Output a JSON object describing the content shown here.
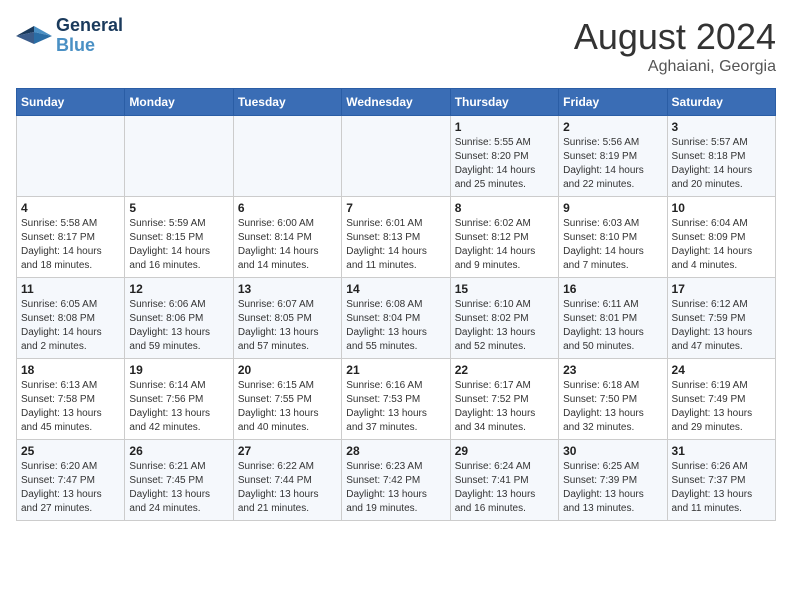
{
  "header": {
    "logo_line1": "General",
    "logo_line2": "Blue",
    "month_year": "August 2024",
    "location": "Aghaiani, Georgia"
  },
  "days_of_week": [
    "Sunday",
    "Monday",
    "Tuesday",
    "Wednesday",
    "Thursday",
    "Friday",
    "Saturday"
  ],
  "weeks": [
    [
      {
        "day": "",
        "info": ""
      },
      {
        "day": "",
        "info": ""
      },
      {
        "day": "",
        "info": ""
      },
      {
        "day": "",
        "info": ""
      },
      {
        "day": "1",
        "info": "Sunrise: 5:55 AM\nSunset: 8:20 PM\nDaylight: 14 hours\nand 25 minutes."
      },
      {
        "day": "2",
        "info": "Sunrise: 5:56 AM\nSunset: 8:19 PM\nDaylight: 14 hours\nand 22 minutes."
      },
      {
        "day": "3",
        "info": "Sunrise: 5:57 AM\nSunset: 8:18 PM\nDaylight: 14 hours\nand 20 minutes."
      }
    ],
    [
      {
        "day": "4",
        "info": "Sunrise: 5:58 AM\nSunset: 8:17 PM\nDaylight: 14 hours\nand 18 minutes."
      },
      {
        "day": "5",
        "info": "Sunrise: 5:59 AM\nSunset: 8:15 PM\nDaylight: 14 hours\nand 16 minutes."
      },
      {
        "day": "6",
        "info": "Sunrise: 6:00 AM\nSunset: 8:14 PM\nDaylight: 14 hours\nand 14 minutes."
      },
      {
        "day": "7",
        "info": "Sunrise: 6:01 AM\nSunset: 8:13 PM\nDaylight: 14 hours\nand 11 minutes."
      },
      {
        "day": "8",
        "info": "Sunrise: 6:02 AM\nSunset: 8:12 PM\nDaylight: 14 hours\nand 9 minutes."
      },
      {
        "day": "9",
        "info": "Sunrise: 6:03 AM\nSunset: 8:10 PM\nDaylight: 14 hours\nand 7 minutes."
      },
      {
        "day": "10",
        "info": "Sunrise: 6:04 AM\nSunset: 8:09 PM\nDaylight: 14 hours\nand 4 minutes."
      }
    ],
    [
      {
        "day": "11",
        "info": "Sunrise: 6:05 AM\nSunset: 8:08 PM\nDaylight: 14 hours\nand 2 minutes."
      },
      {
        "day": "12",
        "info": "Sunrise: 6:06 AM\nSunset: 8:06 PM\nDaylight: 13 hours\nand 59 minutes."
      },
      {
        "day": "13",
        "info": "Sunrise: 6:07 AM\nSunset: 8:05 PM\nDaylight: 13 hours\nand 57 minutes."
      },
      {
        "day": "14",
        "info": "Sunrise: 6:08 AM\nSunset: 8:04 PM\nDaylight: 13 hours\nand 55 minutes."
      },
      {
        "day": "15",
        "info": "Sunrise: 6:10 AM\nSunset: 8:02 PM\nDaylight: 13 hours\nand 52 minutes."
      },
      {
        "day": "16",
        "info": "Sunrise: 6:11 AM\nSunset: 8:01 PM\nDaylight: 13 hours\nand 50 minutes."
      },
      {
        "day": "17",
        "info": "Sunrise: 6:12 AM\nSunset: 7:59 PM\nDaylight: 13 hours\nand 47 minutes."
      }
    ],
    [
      {
        "day": "18",
        "info": "Sunrise: 6:13 AM\nSunset: 7:58 PM\nDaylight: 13 hours\nand 45 minutes."
      },
      {
        "day": "19",
        "info": "Sunrise: 6:14 AM\nSunset: 7:56 PM\nDaylight: 13 hours\nand 42 minutes."
      },
      {
        "day": "20",
        "info": "Sunrise: 6:15 AM\nSunset: 7:55 PM\nDaylight: 13 hours\nand 40 minutes."
      },
      {
        "day": "21",
        "info": "Sunrise: 6:16 AM\nSunset: 7:53 PM\nDaylight: 13 hours\nand 37 minutes."
      },
      {
        "day": "22",
        "info": "Sunrise: 6:17 AM\nSunset: 7:52 PM\nDaylight: 13 hours\nand 34 minutes."
      },
      {
        "day": "23",
        "info": "Sunrise: 6:18 AM\nSunset: 7:50 PM\nDaylight: 13 hours\nand 32 minutes."
      },
      {
        "day": "24",
        "info": "Sunrise: 6:19 AM\nSunset: 7:49 PM\nDaylight: 13 hours\nand 29 minutes."
      }
    ],
    [
      {
        "day": "25",
        "info": "Sunrise: 6:20 AM\nSunset: 7:47 PM\nDaylight: 13 hours\nand 27 minutes."
      },
      {
        "day": "26",
        "info": "Sunrise: 6:21 AM\nSunset: 7:45 PM\nDaylight: 13 hours\nand 24 minutes."
      },
      {
        "day": "27",
        "info": "Sunrise: 6:22 AM\nSunset: 7:44 PM\nDaylight: 13 hours\nand 21 minutes."
      },
      {
        "day": "28",
        "info": "Sunrise: 6:23 AM\nSunset: 7:42 PM\nDaylight: 13 hours\nand 19 minutes."
      },
      {
        "day": "29",
        "info": "Sunrise: 6:24 AM\nSunset: 7:41 PM\nDaylight: 13 hours\nand 16 minutes."
      },
      {
        "day": "30",
        "info": "Sunrise: 6:25 AM\nSunset: 7:39 PM\nDaylight: 13 hours\nand 13 minutes."
      },
      {
        "day": "31",
        "info": "Sunrise: 6:26 AM\nSunset: 7:37 PM\nDaylight: 13 hours\nand 11 minutes."
      }
    ]
  ]
}
